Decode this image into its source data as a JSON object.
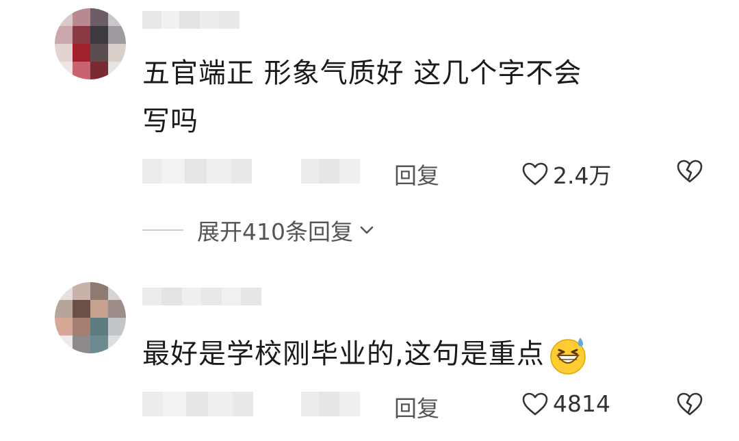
{
  "comments": [
    {
      "text_line1": "五官端正 形象气质好 这几个字不会",
      "text_line2": "写吗",
      "reply_label": "回复",
      "like_count": "2.4万"
    },
    {
      "text_line1": "最好是学校刚毕业的,这句是重点",
      "reply_label": "回复",
      "like_count": "4814",
      "emoji": "grinning-sweat-emoji"
    }
  ],
  "expand_replies": {
    "label": "展开410条回复"
  },
  "icons": {
    "like": "heart-outline-icon",
    "dislike": "broken-heart-icon",
    "expand": "chevron-down-icon"
  }
}
